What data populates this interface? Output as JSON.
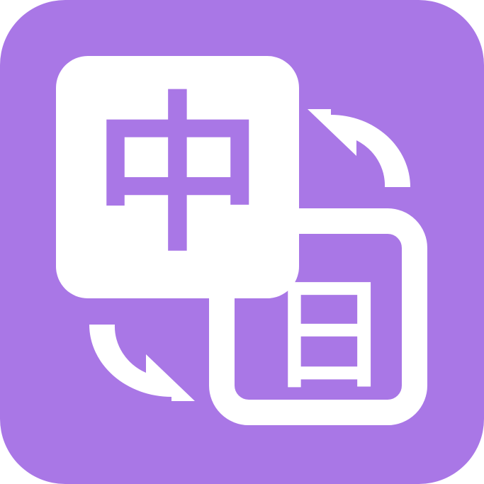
{
  "icon": {
    "name": "chinese-japanese-translator-app-icon",
    "background_color": "#A977E6",
    "foreground_color": "#FFFFFF",
    "source_character": "中",
    "target_character": "日"
  }
}
